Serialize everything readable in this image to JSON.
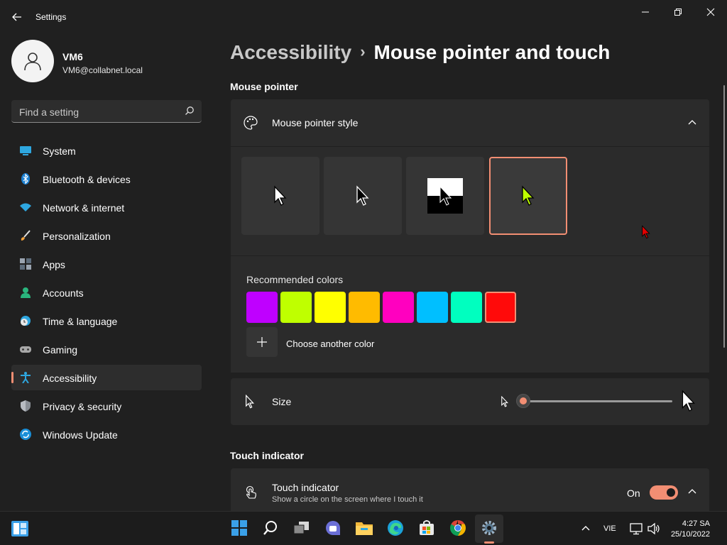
{
  "window": {
    "title": "Settings",
    "back_icon": "back-arrow-icon",
    "controls": [
      "minimize-icon",
      "restore-icon",
      "close-icon"
    ]
  },
  "profile": {
    "name": "VM6",
    "email": "VM6@collabnet.local",
    "avatar_icon": "person-icon"
  },
  "search": {
    "placeholder": "Find a setting",
    "icon": "search-icon"
  },
  "sidebar": {
    "items": [
      {
        "label": "System",
        "icon": "monitor-icon",
        "active": false
      },
      {
        "label": "Bluetooth & devices",
        "icon": "bluetooth-icon",
        "active": false
      },
      {
        "label": "Network & internet",
        "icon": "wifi-icon",
        "active": false
      },
      {
        "label": "Personalization",
        "icon": "brush-icon",
        "active": false
      },
      {
        "label": "Apps",
        "icon": "apps-icon",
        "active": false
      },
      {
        "label": "Accounts",
        "icon": "person-icon",
        "active": false
      },
      {
        "label": "Time & language",
        "icon": "globe-clock-icon",
        "active": false
      },
      {
        "label": "Gaming",
        "icon": "gamepad-icon",
        "active": false
      },
      {
        "label": "Accessibility",
        "icon": "accessibility-icon",
        "active": true
      },
      {
        "label": "Privacy & security",
        "icon": "shield-icon",
        "active": false
      },
      {
        "label": "Windows Update",
        "icon": "update-icon",
        "active": false
      }
    ]
  },
  "breadcrumb": {
    "parent": "Accessibility",
    "separator": "›",
    "current": "Mouse pointer and touch"
  },
  "mouse_pointer": {
    "section_title": "Mouse pointer",
    "style_card": {
      "label": "Mouse pointer style",
      "icon": "palette-icon",
      "expanded": true,
      "styles": [
        {
          "name": "white",
          "selected": false
        },
        {
          "name": "black",
          "selected": false
        },
        {
          "name": "inverted",
          "selected": false
        },
        {
          "name": "custom",
          "selected": true
        }
      ],
      "recommended_label": "Recommended colors",
      "colors": [
        "#bf00ff",
        "#bfff00",
        "#ffff00",
        "#ffbb00",
        "#ff00bf",
        "#00bfff",
        "#00ffbf",
        "#ff0a0a"
      ],
      "selected_color_index": 7,
      "choose_label": "Choose another color",
      "custom_pointer_color": "#bfff00"
    },
    "size": {
      "label": "Size",
      "icon": "cursor-icon",
      "value": 1
    }
  },
  "touch": {
    "section_title": "Touch indicator",
    "title": "Touch indicator",
    "description": "Show a circle on the screen where I touch it",
    "icon": "touch-icon",
    "toggle_label": "On",
    "toggle_on": true
  },
  "taskbar": {
    "apps": [
      "windows-start-icon",
      "search-icon",
      "task-view-icon",
      "chat-icon",
      "file-explorer-icon",
      "edge-icon",
      "store-icon",
      "chrome-icon",
      "settings-icon"
    ],
    "tray": {
      "language": "VIE",
      "time": "4:27 SA",
      "date": "25/10/2022"
    }
  },
  "colors": {
    "accent": "#f28e73",
    "background": "#202020",
    "card": "#2b2b2b"
  }
}
